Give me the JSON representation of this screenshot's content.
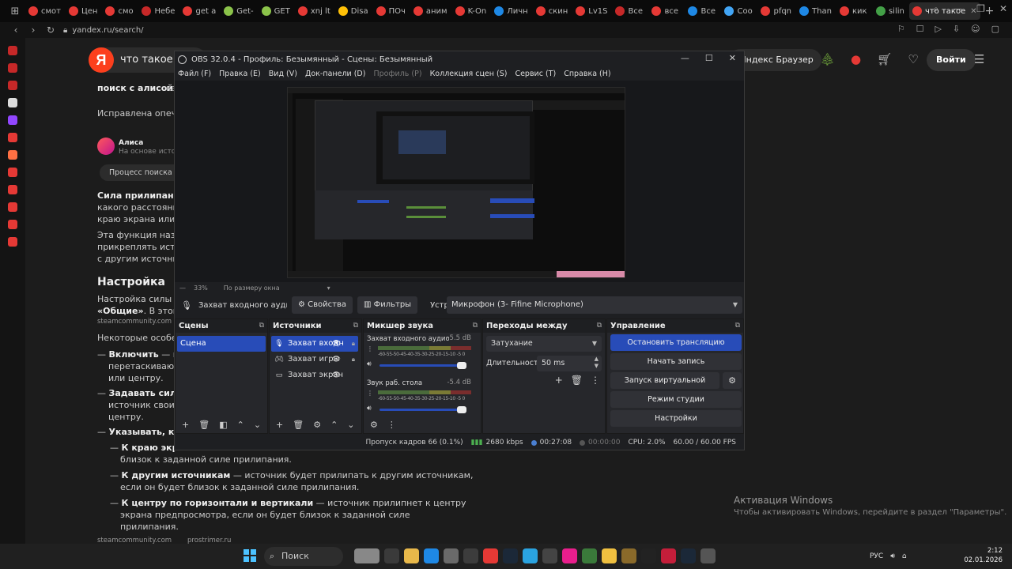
{
  "browser": {
    "tabs": [
      {
        "label": "смот",
        "color": "#e53935"
      },
      {
        "label": "Цен",
        "color": "#e53935"
      },
      {
        "label": "смо",
        "color": "#e53935"
      },
      {
        "label": "Небе",
        "color": "#c62828"
      },
      {
        "label": "get a",
        "color": "#e53935"
      },
      {
        "label": "Get-",
        "color": "#8bc34a"
      },
      {
        "label": "GET",
        "color": "#8bc34a"
      },
      {
        "label": "xnj lt",
        "color": "#e53935"
      },
      {
        "label": "Disa",
        "color": "#ffc107"
      },
      {
        "label": "ПОч",
        "color": "#e53935"
      },
      {
        "label": "аним",
        "color": "#e53935"
      },
      {
        "label": "K-On",
        "color": "#e53935"
      },
      {
        "label": "Личн",
        "color": "#1e88e5"
      },
      {
        "label": "скин",
        "color": "#e53935"
      },
      {
        "label": "Lv1S",
        "color": "#e53935"
      },
      {
        "label": "Все",
        "color": "#c62828"
      },
      {
        "label": "все",
        "color": "#e53935"
      },
      {
        "label": "Все",
        "color": "#1e88e5"
      },
      {
        "label": "Coo",
        "color": "#42a5f5"
      },
      {
        "label": "pfqn",
        "color": "#e53935"
      },
      {
        "label": "Than",
        "color": "#1e88e5"
      },
      {
        "label": "кик",
        "color": "#e53935"
      },
      {
        "label": "silin",
        "color": "#43a047"
      }
    ],
    "active_tab": "что такое",
    "new_tab": "+",
    "address": "yandex.ru/search/"
  },
  "yandex": {
    "logo": "Я",
    "query": "что такое си",
    "browser_button": "Яндекс Браузер",
    "login": "Войти",
    "tab_alice": "поиск с алисой",
    "tab_more": "ка",
    "corrected": "Исправлена опечат",
    "alice_name": "Алиса",
    "alice_sub": "На основе источн",
    "process": "Процесс поиска",
    "p1_bold": "Сила прилипания",
    "p1_rest": " –",
    "p1_l2": "какого расстояния",
    "p1_l3": "краю экрана или с",
    "p2_l1": "Эта функция назыв",
    "p2_l2": "прикреплять источ",
    "p2_l3": "с другим источнико",
    "h_setup": "Настройка",
    "s1": "Настройка силы пр",
    "s2_bold": "«Общие»",
    "s2_rest": ". В этом ра",
    "steam": "steamcommunity.com",
    "features": "Некоторые особен",
    "b1_bold": "Включить",
    "b1_rest": " — вкл",
    "b1_l2": "перетаскивают",
    "b1_l3": "или центру.",
    "b2_bold": "Задавать силу п",
    "b2_l2": "источник своим",
    "b2_l3": "центру.",
    "b3_bold": "Указывать, к как",
    "sb1_bold": "К краю экран",
    "sb1_l2": "близок к заданной силе прилипания.",
    "sb2_bold": "К другим источникам",
    "sb2_rest": " — источник будет прилипать к другим источникам,",
    "sb2_l2": "если он будет близок к заданной силе прилипания.",
    "sb3_bold": "К центру по горизонтали и вертикали",
    "sb3_rest": " — источник прилипнет к центру",
    "sb3_l2": "экрана предпросмотра, если он будет близок к заданной силе",
    "sb3_l3": "прилипания.",
    "src1": "steamcommunity.com",
    "src2": "prostrimer.ru"
  },
  "windows_activation": {
    "title": "Активация Windows",
    "subtitle": "Чтобы активировать Windows, перейдите в раздел \"Параметры\"."
  },
  "obs": {
    "title": "OBS 32.0.4 - Профиль: Безымянный - Сцены: Безымянный",
    "menu": [
      "Файл (F)",
      "Правка (E)",
      "Вид (V)",
      "Док-панели (D)",
      "Профиль (P)",
      "Коллекция сцен (S)",
      "Сервис (T)",
      "Справка (H)"
    ],
    "zoom": "33%",
    "zoom_mode": "По размеру окна",
    "src_toolbar": {
      "source_name": "Захват входного аудиопото",
      "properties": "Свойства",
      "filters": "Фильтры",
      "device_label": "Устройство",
      "device_value": "Микрофон (3- Fifine Microphone)"
    },
    "scenes": {
      "title": "Сцены",
      "items": [
        "Сцена"
      ]
    },
    "sources": {
      "title": "Источники",
      "items": [
        "Захват входн",
        "Захват игры",
        "Захват экран"
      ]
    },
    "mixer": {
      "title": "Микшер звука",
      "channels": [
        {
          "name": "Захват входного аудиопоток",
          "db": "-5.5 dB",
          "level": 0.93
        },
        {
          "name": "Звук раб. стола",
          "db": "-5.4 dB",
          "level": 0.93
        }
      ],
      "scale": "-60-55-50-45-40-35-30-25-20-15-10 -5 0"
    },
    "transitions": {
      "title": "Переходы между сценами",
      "type": "Затухание",
      "duration_label": "Длительность",
      "duration_value": "50 ms"
    },
    "controls": {
      "title": "Управление",
      "stop_stream": "Остановить трансляцию",
      "start_record": "Начать запись",
      "virtual_cam": "Запуск виртуальной камеры",
      "studio_mode": "Режим студии",
      "settings": "Настройки"
    },
    "status": {
      "dropped": "Пропуск кадров 66 (0.1%)",
      "bitrate": "2680 kbps",
      "stream_time": "00:27:08",
      "rec_time": "00:00:00",
      "cpu": "CPU: 2.0%",
      "fps": "60.00 / 60.00 FPS"
    }
  },
  "taskbar": {
    "search": "Поиск",
    "lang": "РУС",
    "time": "2:12",
    "date": "02.01.2026"
  }
}
